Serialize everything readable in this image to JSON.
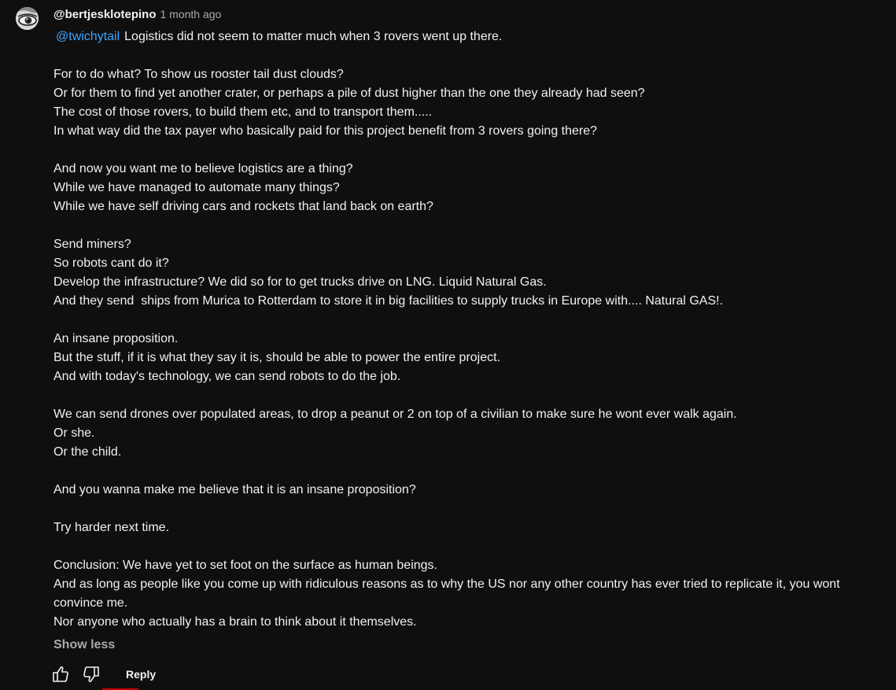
{
  "comment": {
    "author": "@bertjesklotepino",
    "time": "1 month ago",
    "mention": "@twichytail",
    "lines": [
      "Logistics did not seem to matter much when 3 rovers went up there.",
      "",
      "For to do what? To show us rooster tail dust clouds?",
      "Or for them to find yet another crater, or perhaps a pile of dust higher than the one they already had seen?",
      "The cost of those rovers, to build them etc, and to transport them.....",
      "In what way did the tax payer who basically paid for this project benefit from 3 rovers going there?",
      "",
      "And now you want me to believe logistics are a thing?",
      "While we have managed to automate many things?",
      "While we have self driving cars and rockets that land back on earth?",
      "",
      "Send miners?",
      "So robots cant do it?",
      "Develop the infrastructure? We did so for to get trucks drive on LNG. Liquid Natural Gas.",
      "And they send  ships from Murica to Rotterdam to store it in big facilities to supply trucks in Europe with.... Natural GAS!.",
      "",
      "An insane proposition.",
      "But the stuff, if it is what they say it is, should be able to power the entire project.",
      "And with today's technology, we can send robots to do the job.",
      "",
      "We can send drones over populated areas, to drop a peanut or 2 on top of a civilian to make sure he wont ever walk again.",
      "Or she.",
      "Or the child.",
      "",
      "And you wanna make me believe that it is an insane proposition?",
      "",
      "Try harder next time.",
      "",
      "Conclusion: We have yet to set foot on the surface as human beings.",
      "And as long as people like you come up with ridiculous reasons as to why the US nor any other country has ever tried to replicate it, you wont convince me.",
      "Nor anyone who actually has a brain to think about it themselves."
    ],
    "show_less_label": "Show less",
    "reply_label": "Reply"
  },
  "icons": {
    "like": "thumbs-up-icon",
    "dislike": "thumbs-down-icon",
    "avatar": "avatar-image"
  },
  "colors": {
    "background": "#0f0f0f",
    "text": "#f1f1f1",
    "secondary_text": "#aaaaaa",
    "link": "#3ea6ff"
  }
}
